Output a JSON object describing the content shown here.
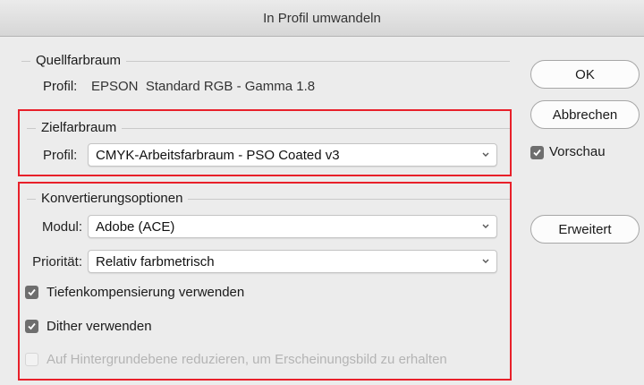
{
  "window": {
    "title": "In Profil umwandeln"
  },
  "source_space": {
    "legend": "Quellfarbraum",
    "profile_label": "Profil:",
    "profile_value": "EPSON  Standard RGB - Gamma 1.8"
  },
  "target_space": {
    "legend": "Zielfarbraum",
    "profile_label": "Profil:",
    "profile_selected": "CMYK-Arbeitsfarbraum - PSO Coated v3"
  },
  "conversion": {
    "legend": "Konvertierungsoptionen",
    "module_label": "Modul:",
    "module_selected": "Adobe (ACE)",
    "priority_label": "Priorität:",
    "priority_selected": "Relativ farbmetrisch",
    "depth_comp_label": "Tiefenkompensierung verwenden",
    "depth_comp_checked": true,
    "dither_label": "Dither verwenden",
    "dither_checked": true,
    "flatten_label": "Auf Hintergrundebene reduzieren, um Erscheinungsbild zu erhalten",
    "flatten_checked": false,
    "flatten_enabled": false
  },
  "buttons": {
    "ok": "OK",
    "cancel": "Abbrechen",
    "preview_label": "Vorschau",
    "preview_checked": true,
    "advanced": "Erweitert"
  },
  "colors": {
    "highlight_border": "#e8202a",
    "checkbox_fill": "#6e6e6e",
    "background": "#ececec"
  }
}
